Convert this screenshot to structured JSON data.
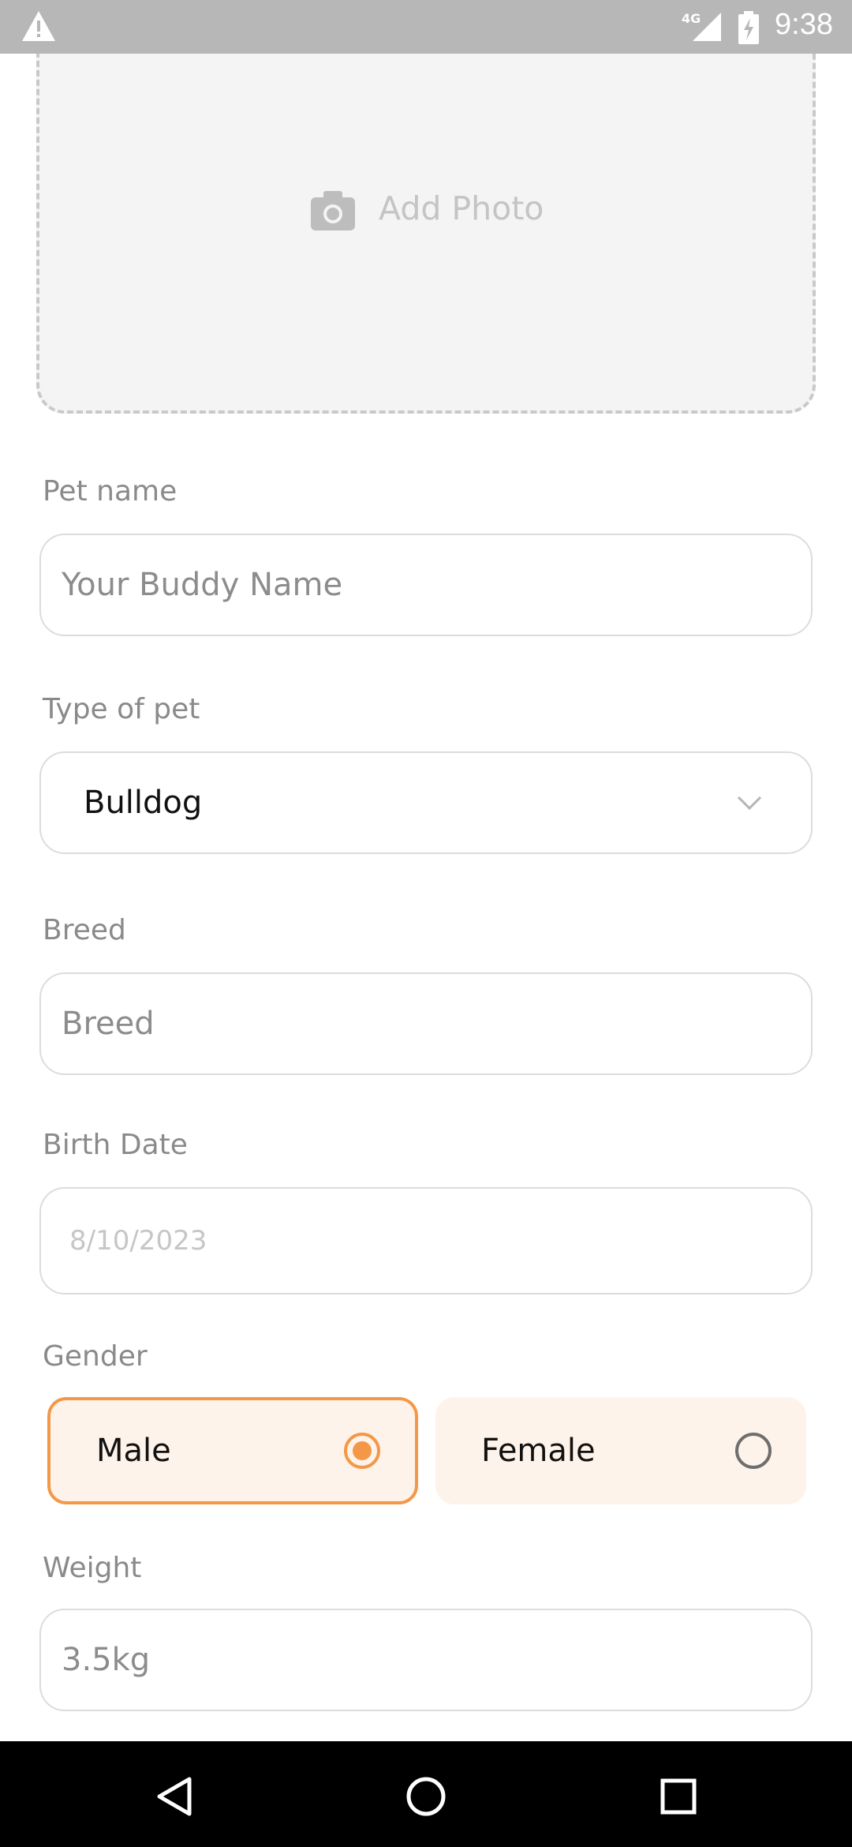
{
  "status_bar": {
    "network": "4G",
    "time": "9:38"
  },
  "photo": {
    "label": "Add Photo",
    "icon": "camera-icon"
  },
  "form": {
    "pet_name": {
      "label": "Pet name",
      "placeholder": "Your Buddy Name"
    },
    "type_of_pet": {
      "label": "Type of pet",
      "value": "Bulldog"
    },
    "breed": {
      "label": "Breed",
      "placeholder": "Breed"
    },
    "birth_date": {
      "label": "Birth Date",
      "placeholder": "8/10/2023"
    },
    "gender": {
      "label": "Gender",
      "options": [
        {
          "label": "Male",
          "selected": true
        },
        {
          "label": "Female",
          "selected": false
        }
      ]
    },
    "weight": {
      "label": "Weight",
      "value": "3.5kg"
    }
  },
  "colors": {
    "accent": "#f49848",
    "card_bg": "#fef3ea",
    "field_border": "#dcdcdc"
  }
}
